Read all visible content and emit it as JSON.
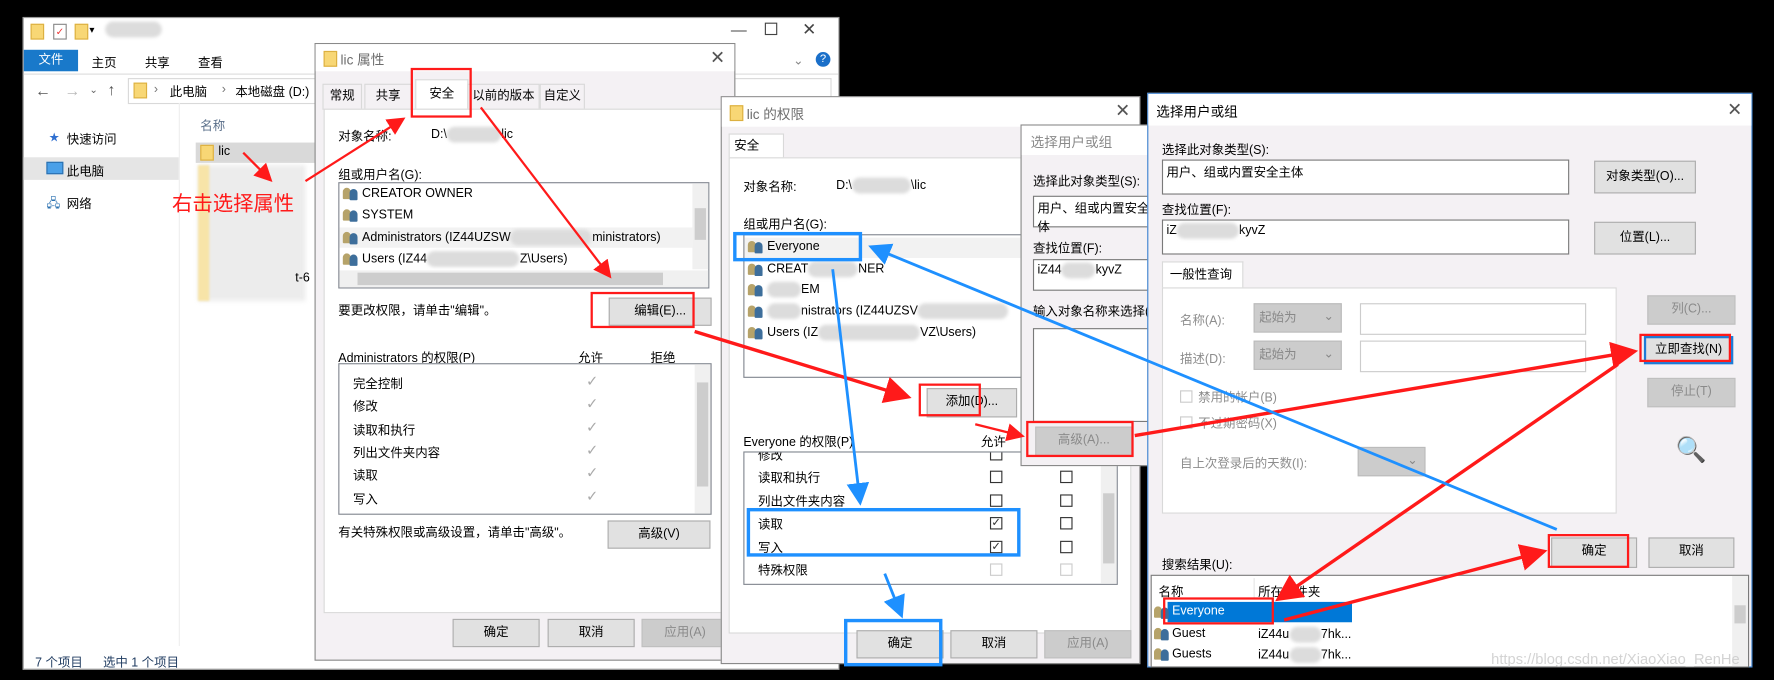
{
  "explorer": {
    "ribbon_tabs": [
      "文件",
      "主页",
      "共享",
      "查看"
    ],
    "address": [
      "此电脑",
      "本地磁盘 (D:)"
    ],
    "nav": [
      "快速访问",
      "此电脑",
      "网络"
    ],
    "column_name": "名称",
    "file_selected": "lic",
    "file_partial": "t-6",
    "status_count": "7 个项目",
    "status_selected": "选中 1 个项目"
  },
  "annotation": "右击选择属性",
  "props": {
    "title": "lic 属性",
    "tabs": [
      "常规",
      "共享",
      "安全",
      "以前的版本",
      "自定义"
    ],
    "object_label": "对象名称:",
    "object_prefix": "D:\\",
    "object_suffix": "lic",
    "group_label": "组或用户名(G):",
    "users": [
      {
        "pre": "CREATOR OWNER",
        "post": ""
      },
      {
        "pre": "SYSTEM",
        "post": ""
      },
      {
        "pre": "Administrators (IZ44UZSW",
        "post": "ministrators)"
      },
      {
        "pre": "Users (IZ44",
        "post": "Z\\Users)"
      }
    ],
    "edit_hint": "要更改权限，请单击\"编辑\"。",
    "edit_button": "编辑(E)...",
    "perm_label": "Administrators 的权限(P)",
    "allow": "允许",
    "deny": "拒绝",
    "perms": [
      "完全控制",
      "修改",
      "读取和执行",
      "列出文件夹内容",
      "读取",
      "写入"
    ],
    "adv_hint": "有关特殊权限或高级设置，请单击\"高级\"。",
    "adv_button": "高级(V)",
    "ok": "确定",
    "cancel": "取消",
    "apply": "应用(A)"
  },
  "perm_dialog": {
    "title": "lic 的权限",
    "tab": "安全",
    "object_label": "对象名称:",
    "object_prefix": "D:\\",
    "object_suffix": "\\lic",
    "group_label": "组或用户名(G):",
    "users": [
      {
        "pre": "Everyone",
        "post": ""
      },
      {
        "pre": "CREAT",
        "post": "NER"
      },
      {
        "pre": "",
        "post": "EM"
      },
      {
        "pre": "",
        "post": "nistrators (IZ44UZSV"
      },
      {
        "pre": "Users (IZ",
        "post": "VZ\\Users)"
      }
    ],
    "add_button": "添加(D)...",
    "perm_label": "Everyone 的权限(P)",
    "allow": "允许",
    "perms": [
      {
        "label": "修改",
        "allow": false,
        "deny": false
      },
      {
        "label": "读取和执行",
        "allow": false,
        "deny": false
      },
      {
        "label": "列出文件夹内容",
        "allow": false,
        "deny": false
      },
      {
        "label": "读取",
        "allow": true,
        "deny": false
      },
      {
        "label": "写入",
        "allow": true,
        "deny": false
      },
      {
        "label": "特殊权限",
        "allow": false,
        "deny": false
      }
    ],
    "ok": "确定",
    "cancel": "取消",
    "apply": "应用(A)"
  },
  "select_small": {
    "title": "选择用户或组",
    "type_label": "选择此对象类型(S):",
    "type_value": "用户、组或内置安全主体",
    "location_label": "查找位置(F):",
    "location_pre": "iZ44",
    "location_post": "kyvZ",
    "enter_label": "输入对象名称来选择(",
    "advanced_button": "高级(A)..."
  },
  "select_big": {
    "title": "选择用户或组",
    "type_label": "选择此对象类型(S):",
    "type_value": "用户、组或内置安全主体",
    "type_button": "对象类型(O)...",
    "location_label": "查找位置(F):",
    "location_pre": "iZ",
    "location_post": "kyvZ",
    "location_button": "位置(L)...",
    "query_tab": "一般性查询",
    "name_label": "名称(A):",
    "desc_label": "描述(D):",
    "starts_with": "起始为",
    "disabled_accounts": "禁用的帐户(B)",
    "no_expire": "不过期密码(X)",
    "days_label": "自上次登录后的天数(I):",
    "columns_button": "列(C)...",
    "find_now_button": "立即查找(N)",
    "stop_button": "停止(T)",
    "ok": "确定",
    "cancel": "取消",
    "results_label": "搜索结果(U):",
    "col_name": "名称",
    "col_folder": "所在文件夹",
    "results": [
      {
        "name": "Everyone",
        "folder_pre": "",
        "folder_post": ""
      },
      {
        "name": "Guest",
        "folder_pre": "iZ44u",
        "folder_post": "7hk..."
      },
      {
        "name": "Guests",
        "folder_pre": "iZ44u",
        "folder_post": "7hk..."
      }
    ]
  },
  "watermark": "https://blog.csdn.net/XiaoXiao_RenHe",
  "colors": {
    "annotation_red": "#ff1a1a",
    "annotation_blue": "#1e90ff",
    "selection": "#0078d7"
  }
}
